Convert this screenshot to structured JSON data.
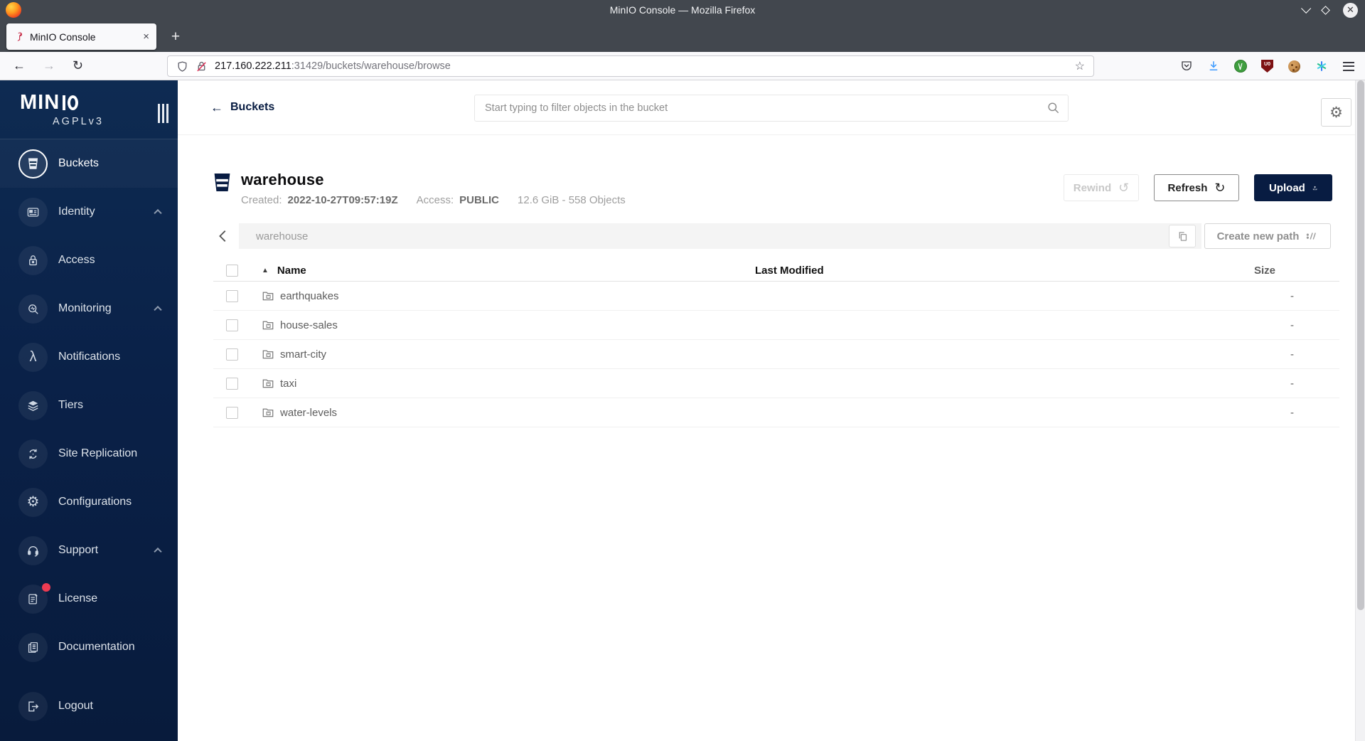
{
  "window": {
    "title": "MinIO Console — Mozilla Firefox"
  },
  "browser": {
    "tab_title": "MinIO Console",
    "tab_close": "×",
    "new_tab": "+",
    "back": "←",
    "forward": "→",
    "reload": "↻",
    "url_host": "217.160.222.211",
    "url_rest": ":31429/buckets/warehouse/browse",
    "bookmark_star": "☆",
    "addon_icons": [
      "pocket",
      "downloads",
      "privacy-badger",
      "ublock-origin",
      "cookie-manager",
      "extension-spark"
    ]
  },
  "sidebar": {
    "logo": "MIN",
    "license_tag": "AGPLv3",
    "items": [
      {
        "label": "Buckets",
        "icon": "bucket",
        "selected": true
      },
      {
        "label": "Identity",
        "icon": "id-card",
        "chevron": true
      },
      {
        "label": "Access",
        "icon": "lock"
      },
      {
        "label": "Monitoring",
        "icon": "monitor-search",
        "chevron": true
      },
      {
        "label": "Notifications",
        "icon": "lambda"
      },
      {
        "label": "Tiers",
        "icon": "layers"
      },
      {
        "label": "Site Replication",
        "icon": "replication"
      },
      {
        "label": "Configurations",
        "icon": "gear"
      },
      {
        "label": "Support",
        "icon": "headset",
        "chevron": true
      },
      {
        "label": "License",
        "icon": "license-doc",
        "badge": true
      },
      {
        "label": "Documentation",
        "icon": "documentation"
      },
      {
        "label": "Logout",
        "icon": "logout"
      }
    ]
  },
  "header": {
    "back_arrow": "←",
    "back_label": "Buckets",
    "search_placeholder": "Start typing to filter objects in the bucket",
    "gear_glyph": "⚙"
  },
  "bucket": {
    "name": "warehouse",
    "created_label": "Created:",
    "created_value": "2022-10-27T09:57:19Z",
    "access_label": "Access:",
    "access_value": "PUBLIC",
    "summary": "12.6 GiB - 558 Objects",
    "rewind_label": "Rewind",
    "rewind_glyph": "↺",
    "refresh_label": "Refresh",
    "refresh_glyph": "↻",
    "upload_label": "Upload"
  },
  "pathbar": {
    "current_path": "warehouse",
    "create_label": "Create new path"
  },
  "table": {
    "sort_arrow": "▲",
    "columns": {
      "name": "Name",
      "last_modified": "Last Modified",
      "size": "Size"
    },
    "rows": [
      {
        "name": "earthquakes",
        "last_modified": "",
        "size": "-"
      },
      {
        "name": "house-sales",
        "last_modified": "",
        "size": "-"
      },
      {
        "name": "smart-city",
        "last_modified": "",
        "size": "-"
      },
      {
        "name": "taxi",
        "last_modified": "",
        "size": "-"
      },
      {
        "name": "water-levels",
        "last_modified": "",
        "size": "-"
      }
    ]
  },
  "colors": {
    "navy": "#081c42",
    "sidebar_top": "#0e2b52",
    "badge_red": "#ed3b52",
    "titlebar": "#42474e",
    "toolbar_bg": "#f9f9fb",
    "path_bar_bg": "#f4f4f4"
  }
}
